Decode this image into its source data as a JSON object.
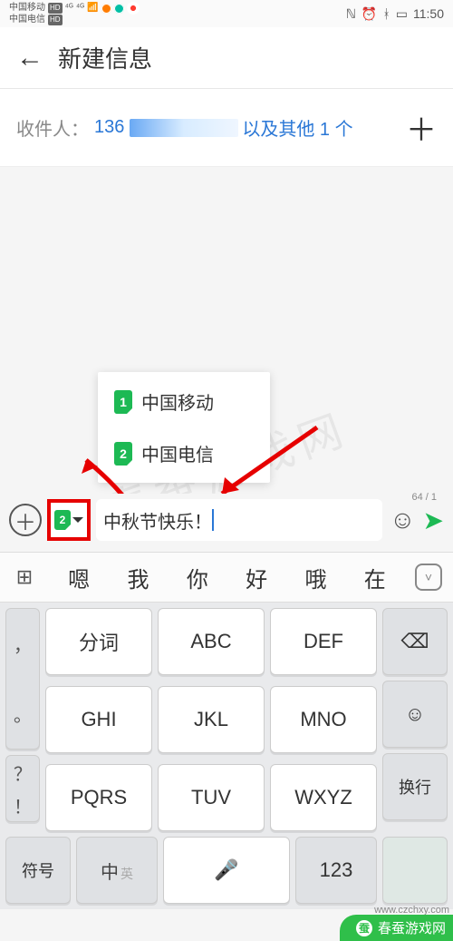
{
  "statusBar": {
    "carrier1": "中国移动",
    "carrier2": "中国电信",
    "hd": "HD",
    "sig": "⁴ᴳ",
    "time": "11:50",
    "icons": {
      "nfc": "NFC",
      "alarm": "⏰",
      "bt": "BT",
      "battery": "▮▮▯"
    }
  },
  "header": {
    "title": "新建信息"
  },
  "recipient": {
    "label": "收件人：",
    "number": "136",
    "other": "以及其他 1 个"
  },
  "simPopup": {
    "items": [
      {
        "num": "1",
        "name": "中国移动"
      },
      {
        "num": "2",
        "name": "中国电信"
      }
    ]
  },
  "compose": {
    "simNum": "2",
    "text": "中秋节快乐！",
    "counter": "64 / 1"
  },
  "suggestions": [
    "嗯",
    "我",
    "你",
    "好",
    "哦",
    "在"
  ],
  "keyboard": {
    "punct1": [
      "，",
      "。",
      "？",
      "！"
    ],
    "row1": [
      "分词",
      "ABC",
      "DEF"
    ],
    "row2": [
      "GHI",
      "JKL",
      "MNO"
    ],
    "row3": [
      "PQRS",
      "TUV",
      "WXYZ"
    ],
    "backKey": "⌫",
    "smileKey": "☺",
    "enterKey": "换行",
    "bottom": {
      "sym": "符号",
      "lang": "中",
      "langSub": "英",
      "space": "⎵",
      "num": "123"
    }
  },
  "brand": {
    "name": "春蚕游戏网",
    "url": "www.czchxy.com"
  }
}
